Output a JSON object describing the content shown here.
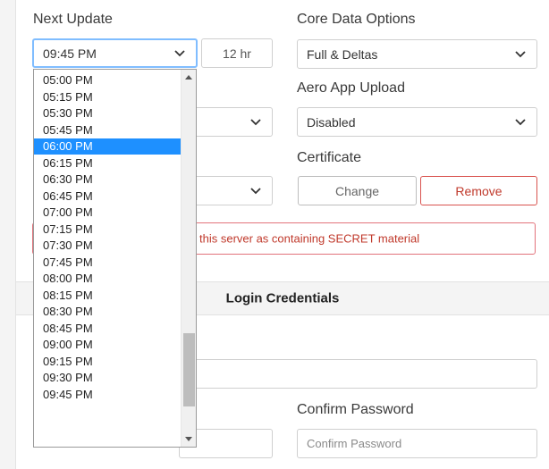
{
  "next_update": {
    "label": "Next Update",
    "selected_value": "09:45 PM",
    "format_button": "12 hr",
    "options": [
      "05:00 PM",
      "05:15 PM",
      "05:30 PM",
      "05:45 PM",
      "06:00 PM",
      "06:15 PM",
      "06:30 PM",
      "06:45 PM",
      "07:00 PM",
      "07:15 PM",
      "07:30 PM",
      "07:45 PM",
      "08:00 PM",
      "08:15 PM",
      "08:30 PM",
      "08:45 PM",
      "09:00 PM",
      "09:15 PM",
      "09:30 PM",
      "09:45 PM"
    ],
    "highlighted_option": "06:00 PM"
  },
  "core_data": {
    "label": "Core Data Options",
    "value": "Full & Deltas"
  },
  "aero_upload": {
    "label": "Aero App Upload",
    "value": "Disabled"
  },
  "certificate": {
    "label": "Certificate",
    "change_label": "Change",
    "remove_label": "Remove"
  },
  "secret_alert": {
    "text": "this server as containing SECRET material"
  },
  "login": {
    "section_title": "Login Credentials",
    "confirm_password_label": "Confirm Password",
    "confirm_password_placeholder": "Confirm Password"
  },
  "colors": {
    "highlight": "#1e90ff",
    "danger": "#c0392b",
    "focus": "#80bdff"
  },
  "icons": {
    "select_arrow": "chevron-down-icon",
    "scroll_up": "triangle-up-icon",
    "scroll_down": "triangle-down-icon"
  },
  "dropdown_scroll_position": 0.9
}
